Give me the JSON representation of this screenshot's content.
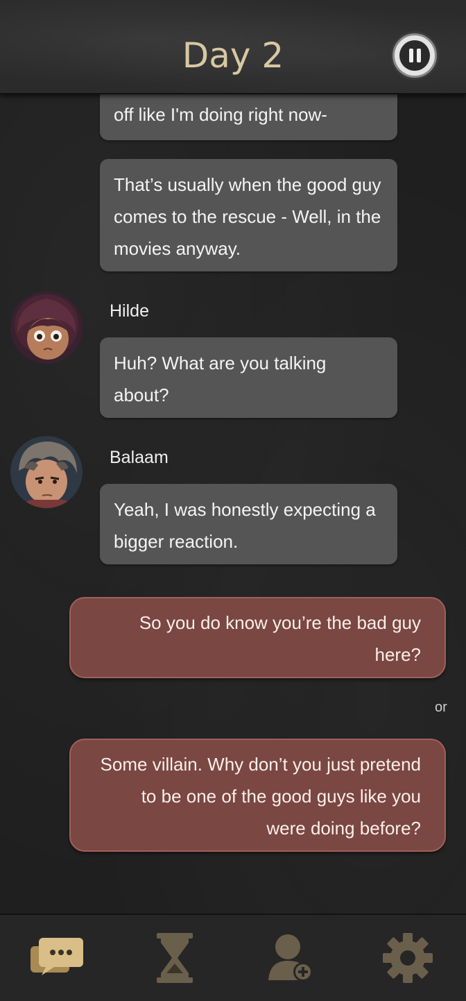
{
  "header": {
    "title": "Day 2",
    "pause_icon": "pause-icon"
  },
  "messages": [
    {
      "text": "off like I'm doing right now-"
    },
    {
      "text": "That’s usually when the good guy comes to the rescue - Well, in the movies anyway."
    },
    {
      "speaker": "Hilde",
      "text": "Huh? What are you talking about?"
    },
    {
      "speaker": "Balaam",
      "text": "Yeah, I was honestly expecting a bigger reaction."
    }
  ],
  "choices": [
    {
      "text": "So you do know you’re the bad guy here?"
    },
    {
      "text": "Some villain. Why don’t you just pretend to be one of the good guys like you were doing before?"
    }
  ],
  "choice_separator": "or",
  "tabbar": {
    "items": [
      {
        "icon": "chat-icon",
        "active": true
      },
      {
        "icon": "hourglass-icon",
        "active": false
      },
      {
        "icon": "add-user-icon",
        "active": false
      },
      {
        "icon": "gear-icon",
        "active": false
      }
    ]
  },
  "colors": {
    "background": "#1f1f1f",
    "npc_bubble": "#555555",
    "choice_bubble": "#7a4742",
    "title": "#d8c7a3",
    "tab_active": "#d9bf87",
    "tab_inactive": "#6a5f4b"
  }
}
